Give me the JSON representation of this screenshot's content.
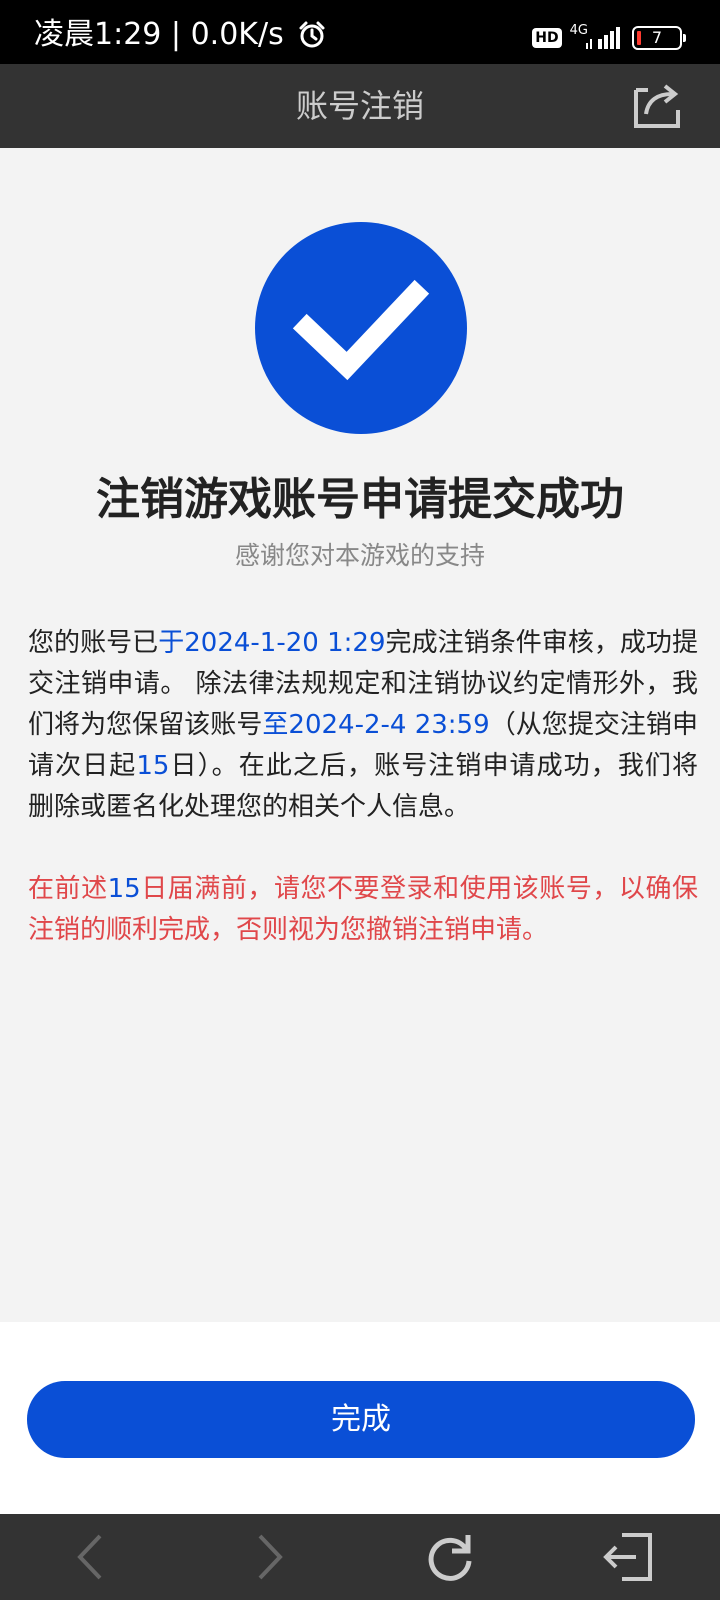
{
  "status_bar": {
    "time": "凌晨1:29",
    "network_speed": "0.0K/s",
    "hd": "HD",
    "network_type": "4G",
    "battery": "7"
  },
  "header": {
    "title": "账号注销"
  },
  "result": {
    "title": "注销游戏账号申请提交成功",
    "subtitle": "感谢您对本游戏的支持"
  },
  "info_paragraph": {
    "p1": "您的账号已",
    "date1": "于2024-1-20 1:29",
    "p2": "完成注销条件审核，成功提交注销申请。 除法律法规规定和注销协议约定情形外，我们将为您保留该账号",
    "date2": "至2024-2-4 23:59",
    "p3": "（从您提交注销申请次日起",
    "days": "15",
    "p4": "日）。在此之后，账号注销申请成功，我们将删除或匿名化处理您的相关个人信息。"
  },
  "warning_paragraph": {
    "p1": "在前述",
    "days": "15",
    "p2": "日届满前，请您不要登录和使用该账号，以确保注销的顺利完成，否则视为您撤销注销申请。"
  },
  "done_button": {
    "label": "完成"
  },
  "colors": {
    "accent": "#0a4fd6",
    "warning": "#e0474a",
    "nav_bg": "#333333"
  },
  "icons": [
    "alarm-icon",
    "signal-icon",
    "battery-icon",
    "share-icon",
    "check-icon",
    "back-icon",
    "forward-icon",
    "refresh-icon",
    "exit-icon"
  ]
}
